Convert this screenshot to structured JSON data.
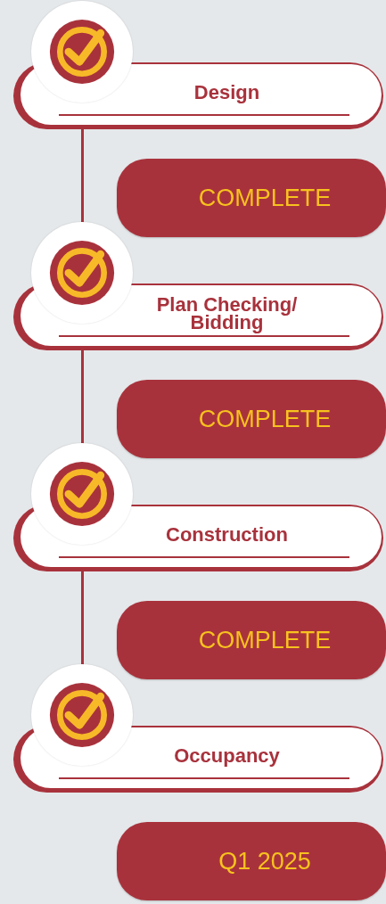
{
  "stages": [
    {
      "title": "Design",
      "status": "COMPLETE"
    },
    {
      "title": "Plan Checking/ Bidding",
      "status": "COMPLETE"
    },
    {
      "title": "Construction",
      "status": "COMPLETE"
    },
    {
      "title": "Occupancy",
      "status": "Q1 2025"
    }
  ]
}
